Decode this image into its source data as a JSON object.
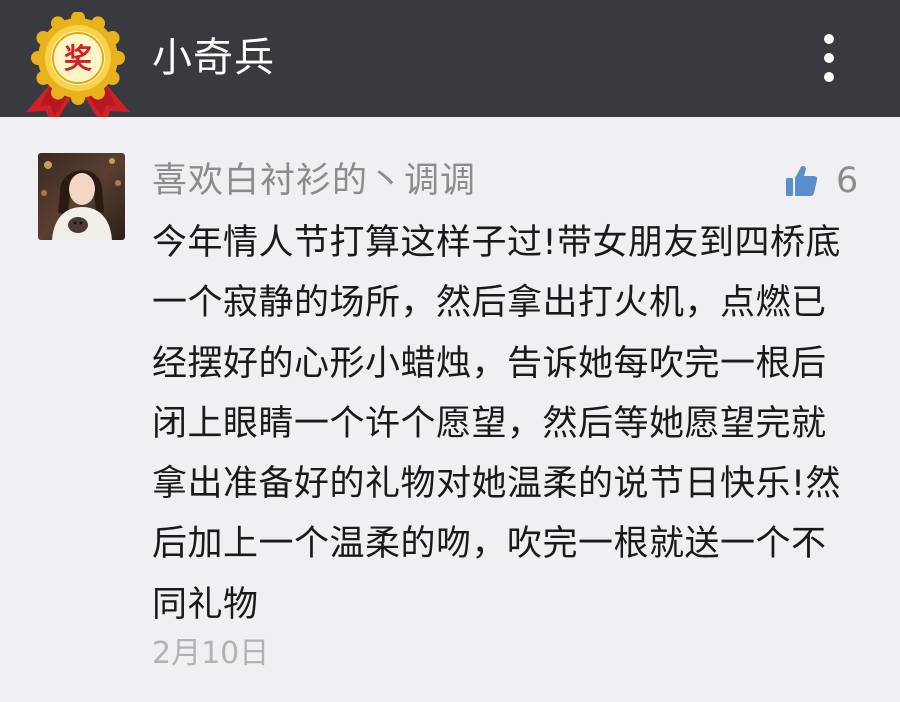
{
  "header": {
    "title": "小奇兵",
    "badge_text": "奖",
    "badge_icon": "award-ribbon-icon",
    "menu_icon": "more-vertical-icon"
  },
  "comment": {
    "username": "喜欢白衬衫的丶调调",
    "like_icon": "thumbs-up-icon",
    "like_count": "6",
    "text": "今年情人节打算这样子过!带女朋友到四桥底一个寂静的场所，然后拿出打火机，点燃已经摆好的心形小蜡烛，告诉她每吹完一根后闭上眼睛一个许个愿望，然后等她愿望完就拿出准备好的礼物对她温柔的说节日快乐!然后加上一个温柔的吻，吹完一根就送一个不同礼物",
    "date": "2月10日"
  },
  "colors": {
    "header_bg": "#393a3f",
    "page_bg": "#efeff4",
    "like_blue": "#5b8fcc",
    "muted_text": "#8c8c8c"
  }
}
